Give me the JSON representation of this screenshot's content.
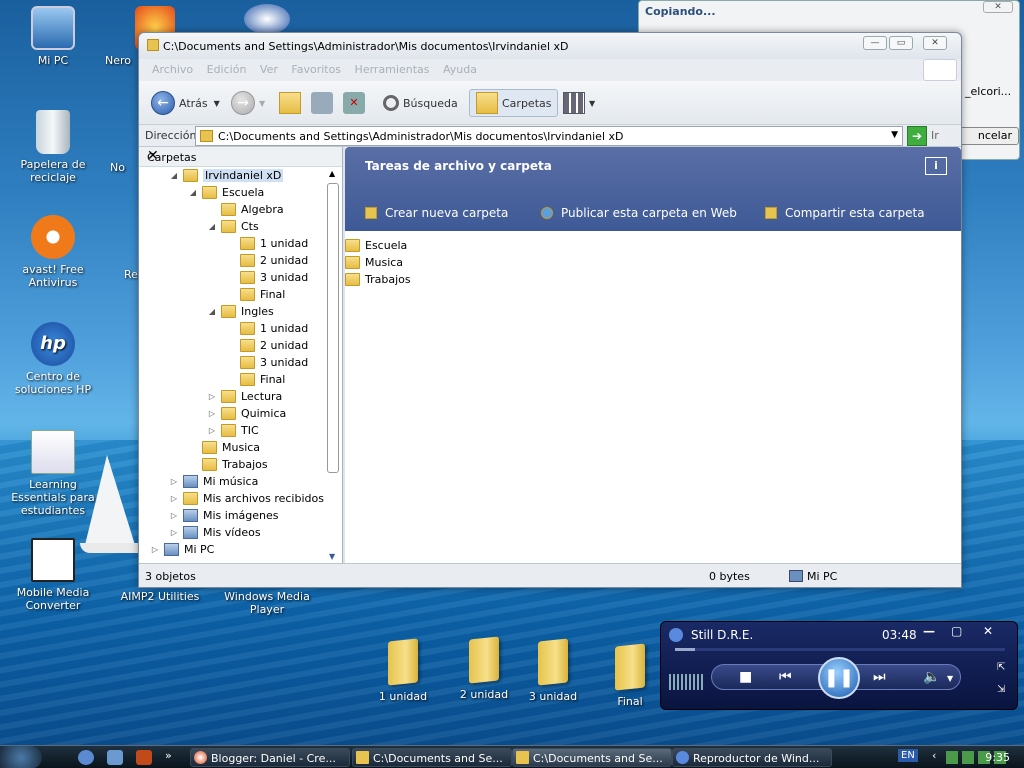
{
  "desktop": {
    "icons": [
      {
        "label": "Mi PC",
        "name": "my-pc-icon"
      },
      {
        "label": "Nero",
        "name": "nero-icon"
      },
      {
        "label": "Papelera de reciclaje",
        "name": "recycle-bin-icon"
      },
      {
        "label": "No",
        "name": "partial-icon-no"
      },
      {
        "label": "avast! Free Antivirus",
        "name": "avast-icon"
      },
      {
        "label": "Re",
        "name": "partial-icon-re"
      },
      {
        "label": "Centro de soluciones HP",
        "name": "hp-icon"
      },
      {
        "label": "Learning Essentials para estudiantes",
        "name": "learning-essentials-icon"
      },
      {
        "label": "Mobile Media Converter",
        "name": "mobile-media-converter-icon"
      },
      {
        "label": "AIMP2 Utilities",
        "name": "aimp2-icon"
      },
      {
        "label": "Windows Media Player",
        "name": "wmp-icon"
      }
    ],
    "folders": [
      "1 unidad",
      "2 unidad",
      "3 unidad",
      "Final"
    ]
  },
  "copy_dialog": {
    "title": "Copiando...",
    "path_fragment": "_elcori...",
    "cancel_label": "ncelar"
  },
  "explorer": {
    "title": "C:\\Documents and Settings\\Administrador\\Mis documentos\\Irvindaniel xD",
    "menu": [
      "Archivo",
      "Edición",
      "Ver",
      "Favoritos",
      "Herramientas",
      "Ayuda"
    ],
    "toolbar": {
      "back": "Atrás",
      "search": "Búsqueda",
      "folders": "Carpetas"
    },
    "address": {
      "label": "Dirección",
      "value": "C:\\Documents and Settings\\Administrador\\Mis documentos\\Irvindaniel xD",
      "go": "Ir"
    },
    "folders_pane": {
      "title": "Carpetas",
      "tree": [
        {
          "label": "Irvindaniel xD",
          "exp": "◢",
          "lvl": 0,
          "type": "folder",
          "sel": true
        },
        {
          "label": "Escuela",
          "exp": "◢",
          "lvl": 1,
          "type": "folder"
        },
        {
          "label": "Algebra",
          "exp": "",
          "lvl": 2,
          "type": "folder"
        },
        {
          "label": "Cts",
          "exp": "◢",
          "lvl": 2,
          "type": "folder"
        },
        {
          "label": "1 unidad",
          "exp": "",
          "lvl": 3,
          "type": "folder"
        },
        {
          "label": "2 unidad",
          "exp": "",
          "lvl": 3,
          "type": "folder"
        },
        {
          "label": "3 unidad",
          "exp": "",
          "lvl": 3,
          "type": "folder"
        },
        {
          "label": "Final",
          "exp": "",
          "lvl": 3,
          "type": "folder"
        },
        {
          "label": "Ingles",
          "exp": "◢",
          "lvl": 2,
          "type": "folder"
        },
        {
          "label": "1 unidad",
          "exp": "",
          "lvl": 3,
          "type": "folder"
        },
        {
          "label": "2 unidad",
          "exp": "",
          "lvl": 3,
          "type": "folder"
        },
        {
          "label": "3 unidad",
          "exp": "",
          "lvl": 3,
          "type": "folder"
        },
        {
          "label": "Final",
          "exp": "",
          "lvl": 3,
          "type": "folder"
        },
        {
          "label": "Lectura",
          "exp": "▷",
          "lvl": 2,
          "type": "folder"
        },
        {
          "label": "Quimica",
          "exp": "▷",
          "lvl": 2,
          "type": "folder"
        },
        {
          "label": "TIC",
          "exp": "▷",
          "lvl": 2,
          "type": "folder"
        },
        {
          "label": "Musica",
          "exp": "",
          "lvl": 1,
          "type": "folder"
        },
        {
          "label": "Trabajos",
          "exp": "",
          "lvl": 1,
          "type": "folder"
        },
        {
          "label": "Mi música",
          "exp": "▷",
          "lvl": 0,
          "type": "special"
        },
        {
          "label": "Mis archivos recibidos",
          "exp": "▷",
          "lvl": 0,
          "type": "folder"
        },
        {
          "label": "Mis imágenes",
          "exp": "▷",
          "lvl": 0,
          "type": "special"
        },
        {
          "label": "Mis vídeos",
          "exp": "▷",
          "lvl": 0,
          "type": "special"
        },
        {
          "label": "Mi PC",
          "exp": "▷",
          "lvl": -1,
          "type": "special"
        }
      ]
    },
    "tasks": {
      "heading": "Tareas de archivo y carpeta",
      "items": [
        "Crear nueva carpeta",
        "Publicar esta carpeta en Web",
        "Compartir esta carpeta"
      ]
    },
    "items": [
      "Escuela",
      "Musica",
      "Trabajos"
    ],
    "status": {
      "count": "3 objetos",
      "size": "0 bytes",
      "location": "Mi PC"
    }
  },
  "media_player": {
    "track": "Still D.R.E.",
    "time": "03:48",
    "progress": 0.06
  },
  "taskbar": {
    "tasks": [
      "Blogger: Daniel - Cre...",
      "C:\\Documents and Se...",
      "C:\\Documents and Se...",
      "Reproductor de Wind..."
    ],
    "lang": "EN",
    "clock": "9:35"
  }
}
